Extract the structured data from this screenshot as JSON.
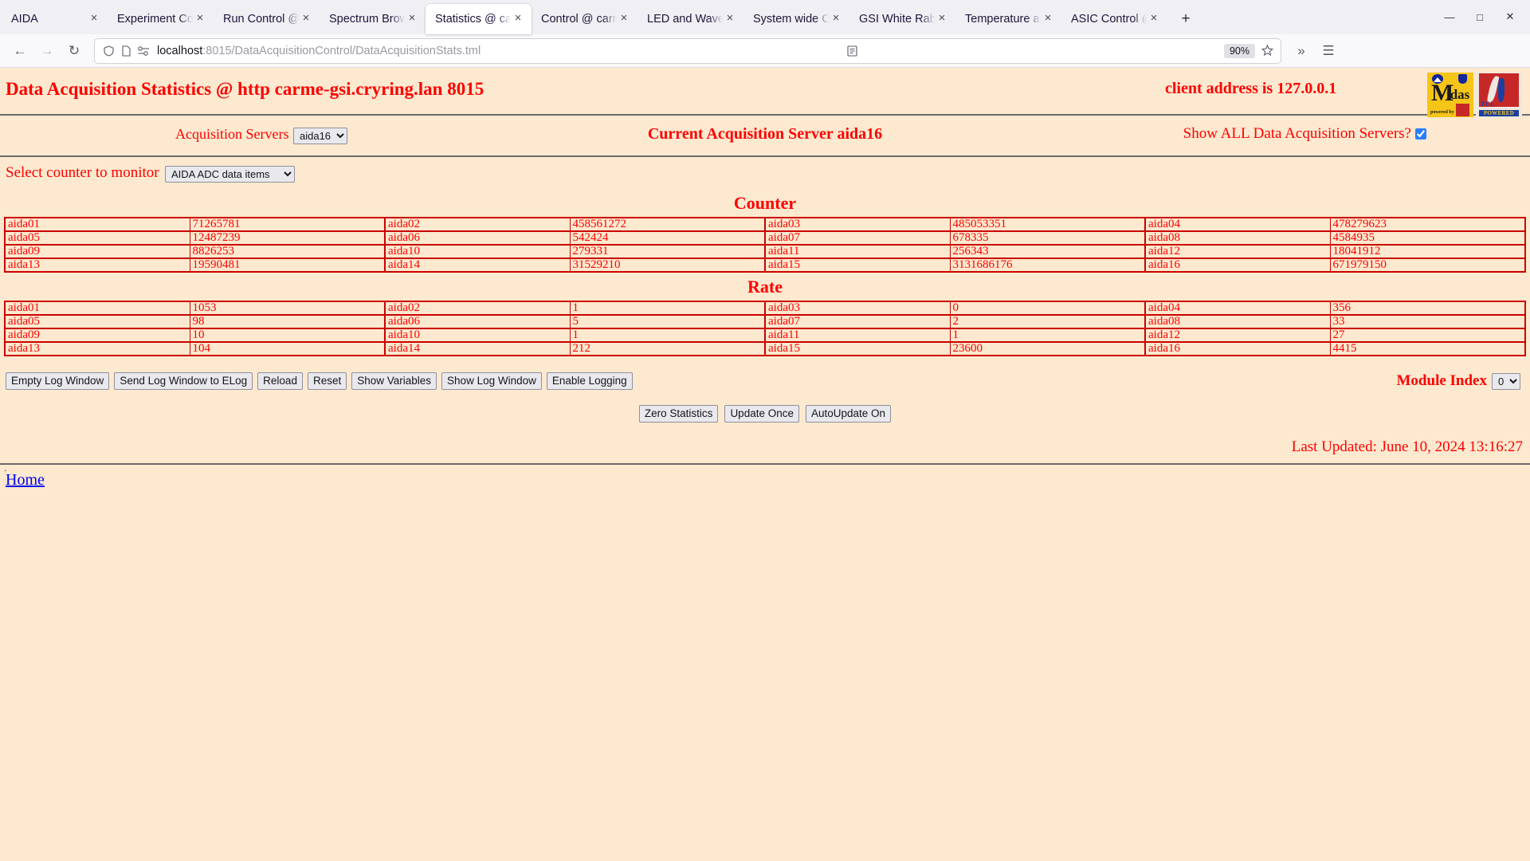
{
  "browser": {
    "tabs": [
      {
        "label": "AIDA",
        "active": false
      },
      {
        "label": "Experiment Control",
        "active": false
      },
      {
        "label": "Run Control @ carme-g",
        "active": false
      },
      {
        "label": "Spectrum Browser",
        "active": false
      },
      {
        "label": "Statistics @ carme-",
        "active": true
      },
      {
        "label": "Control @ carme-gsi",
        "active": false
      },
      {
        "label": "LED and Waveform",
        "active": false
      },
      {
        "label": "System wide Check",
        "active": false
      },
      {
        "label": "GSI White Rabbit Ti",
        "active": false
      },
      {
        "label": "Temperature and st",
        "active": false
      },
      {
        "label": "ASIC Control @ car",
        "active": false
      }
    ],
    "tab_close_icon": "×",
    "new_tab_icon": "+",
    "window_controls": {
      "minimize": "—",
      "maximize": "□",
      "close": "✕"
    },
    "nav": {
      "back": "←",
      "forward": "→",
      "reload": "↻"
    },
    "url": {
      "host": "localhost",
      "rest": ":8015/DataAcquisitionControl/DataAcquisitionStats.tml"
    },
    "zoom_level": "90%",
    "bookmark_icon": "☆",
    "reader_icon": "Ὄ4",
    "shield_icon": "⬡",
    "overflow_icon": "»",
    "menu_icon": "☰"
  },
  "page": {
    "title": "Data Acquisition Statistics @ http carme-gsi.cryring.lan 8015",
    "client_address": "client address is 127.0.0.1",
    "logos": {
      "midas_m": "M",
      "midas_idas": "idas",
      "midas_powered_by": "powered by",
      "tcl_label": "TCL",
      "tcl_powered": "POWERED"
    },
    "controls": {
      "acquisition_servers_label": "Acquisition Servers",
      "acquisition_server_value": "aida16",
      "acquisition_server_options": [
        "aida16"
      ],
      "current_server_title": "Current Acquisition Server aida16",
      "show_all_label": "Show ALL Data Acquisition Servers?",
      "show_all_checked": true,
      "counter_select_label": "Select counter to monitor",
      "counter_select_value": "AIDA ADC data items",
      "counter_select_options": [
        "AIDA ADC data items"
      ]
    },
    "counter": {
      "heading": "Counter",
      "rows": [
        [
          {
            "name": "aida01",
            "value": "71265781"
          },
          {
            "name": "aida02",
            "value": "458561272"
          },
          {
            "name": "aida03",
            "value": "485053351"
          },
          {
            "name": "aida04",
            "value": "478279623"
          }
        ],
        [
          {
            "name": "aida05",
            "value": "12487239"
          },
          {
            "name": "aida06",
            "value": "542424"
          },
          {
            "name": "aida07",
            "value": "678335"
          },
          {
            "name": "aida08",
            "value": "4584935"
          }
        ],
        [
          {
            "name": "aida09",
            "value": "8826253"
          },
          {
            "name": "aida10",
            "value": "279331"
          },
          {
            "name": "aida11",
            "value": "256343"
          },
          {
            "name": "aida12",
            "value": "18041912"
          }
        ],
        [
          {
            "name": "aida13",
            "value": "19590481"
          },
          {
            "name": "aida14",
            "value": "31529210"
          },
          {
            "name": "aida15",
            "value": "3131686176"
          },
          {
            "name": "aida16",
            "value": "671979150"
          }
        ]
      ]
    },
    "rate": {
      "heading": "Rate",
      "rows": [
        [
          {
            "name": "aida01",
            "value": "1053"
          },
          {
            "name": "aida02",
            "value": "1"
          },
          {
            "name": "aida03",
            "value": "0"
          },
          {
            "name": "aida04",
            "value": "356"
          }
        ],
        [
          {
            "name": "aida05",
            "value": "98"
          },
          {
            "name": "aida06",
            "value": "5"
          },
          {
            "name": "aida07",
            "value": "2"
          },
          {
            "name": "aida08",
            "value": "33"
          }
        ],
        [
          {
            "name": "aida09",
            "value": "10"
          },
          {
            "name": "aida10",
            "value": "1"
          },
          {
            "name": "aida11",
            "value": "1"
          },
          {
            "name": "aida12",
            "value": "27"
          }
        ],
        [
          {
            "name": "aida13",
            "value": "104"
          },
          {
            "name": "aida14",
            "value": "212"
          },
          {
            "name": "aida15",
            "value": "23600"
          },
          {
            "name": "aida16",
            "value": "4415"
          }
        ]
      ]
    },
    "toolbar_buttons": [
      "Empty Log Window",
      "Send Log Window to ELog",
      "Reload",
      "Reset",
      "Show Variables",
      "Show Log Window",
      "Enable Logging"
    ],
    "module_index_label": "Module Index",
    "module_index_value": "0",
    "module_index_options": [
      "0"
    ],
    "action_buttons": [
      "Zero Statistics",
      "Update Once",
      "AutoUpdate On"
    ],
    "last_updated": "Last Updated: June 10, 2024 13:16:27",
    "home_link": "Home"
  }
}
